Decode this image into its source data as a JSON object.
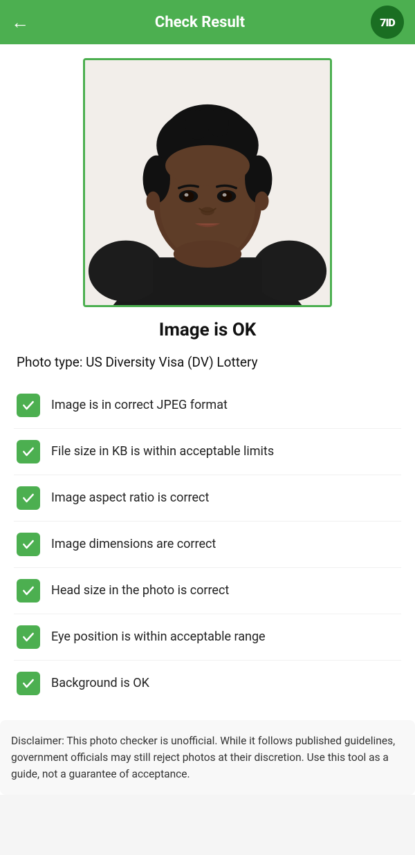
{
  "header": {
    "back_label": "←",
    "title": "Check Result",
    "logo_text": "7ID"
  },
  "photo": {
    "alt": "Passport photo of a young woman"
  },
  "status": {
    "title": "Image is OK"
  },
  "photo_type_label": "Photo type: US Diversity Visa (DV) Lottery",
  "checklist": [
    {
      "id": "jpeg",
      "label": "Image is in correct JPEG format"
    },
    {
      "id": "filesize",
      "label": "File size in KB is within acceptable limits"
    },
    {
      "id": "aspect",
      "label": "Image aspect ratio is correct"
    },
    {
      "id": "dimensions",
      "label": "Image dimensions are correct"
    },
    {
      "id": "headsize",
      "label": "Head size in the photo is correct"
    },
    {
      "id": "eyepos",
      "label": "Eye position is within acceptable range"
    },
    {
      "id": "background",
      "label": "Background is OK"
    }
  ],
  "disclaimer": {
    "text": "Disclaimer: This photo checker is unofficial. While it follows published guidelines, government officials may still reject photos at their discretion. Use this tool as a guide, not a guarantee of acceptance."
  }
}
